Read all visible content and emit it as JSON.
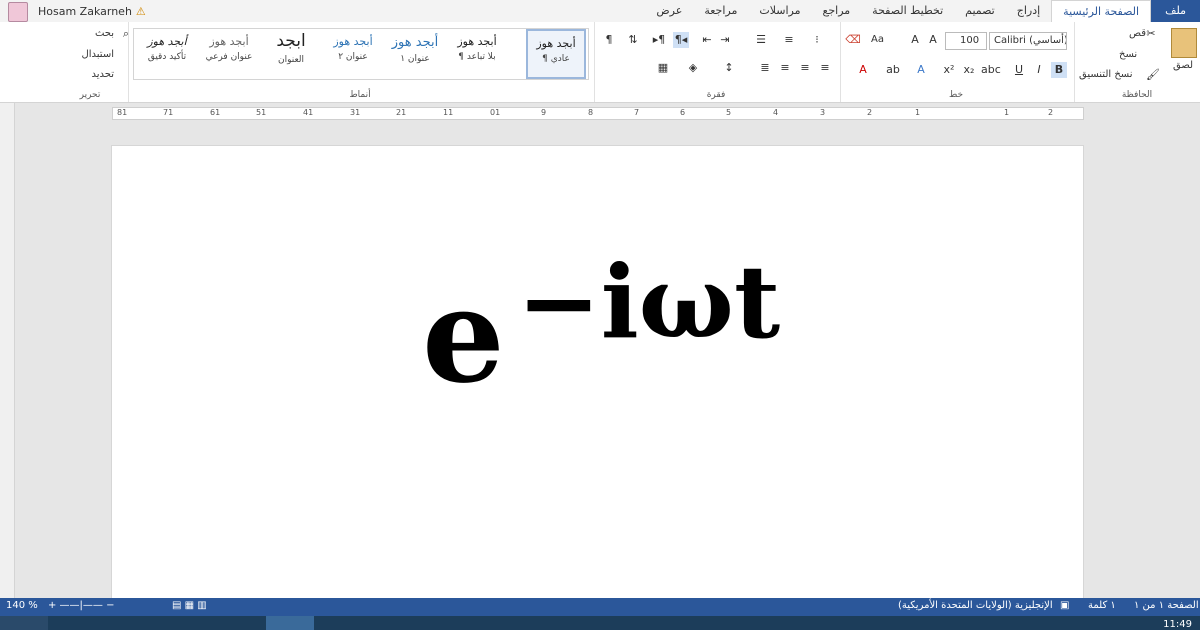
{
  "user": {
    "name": "Hosam Zakarneh"
  },
  "tabs": [
    "ملف",
    "الصفحة الرئيسية",
    "إدراج",
    "تصميم",
    "تخطيط الصفحة",
    "مراجع",
    "مراسلات",
    "مراجعة",
    "عرض"
  ],
  "ribbon": {
    "clipboard": {
      "label": "الحافظة",
      "paste": "لصق",
      "cut": "قص",
      "copy": "نسخ",
      "format_painter": "نسخ التنسيق"
    },
    "font": {
      "label": "خط",
      "name": "Calibri (أساسي)",
      "size": "100",
      "aa": "Aa",
      "bold": "B",
      "italic": "I",
      "underline": "U"
    },
    "paragraph": {
      "label": "فقرة"
    },
    "styles": {
      "label": "أنماط",
      "items": [
        {
          "preview": "أبجد هوز",
          "name": "¶ عادي"
        },
        {
          "preview": "أبجد هوز",
          "name": "¶ بلا تباعد"
        },
        {
          "preview": "أبجد هوز",
          "name": "عنوان ١"
        },
        {
          "preview": "أبجد هوز",
          "name": "عنوان ٢"
        },
        {
          "preview": "ابجد",
          "name": "العنوان"
        },
        {
          "preview": "أبجد هوز",
          "name": "عنوان فرعي"
        },
        {
          "preview": "أبجد هوز",
          "name": "تأكيد دقيق"
        }
      ]
    },
    "editing": {
      "label": "تحرير",
      "find": "بحث",
      "replace": "استبدال",
      "select": "تحديد"
    }
  },
  "ruler_numbers": [
    "2",
    "1",
    "1",
    "2",
    "3",
    "4",
    "5",
    "6",
    "7",
    "8",
    "9",
    "01",
    "11",
    "21",
    "31",
    "41",
    "51",
    "61",
    "71",
    "81"
  ],
  "document": {
    "equation_base": "e",
    "equation_superscript": "−iωt"
  },
  "status": {
    "page": "الصفحة ١ من ١",
    "words": "١ كلمة",
    "language": "الإنجليزية (الولايات المتحدة الأمريكية)",
    "zoom": "140 %"
  },
  "clock": "11:49"
}
